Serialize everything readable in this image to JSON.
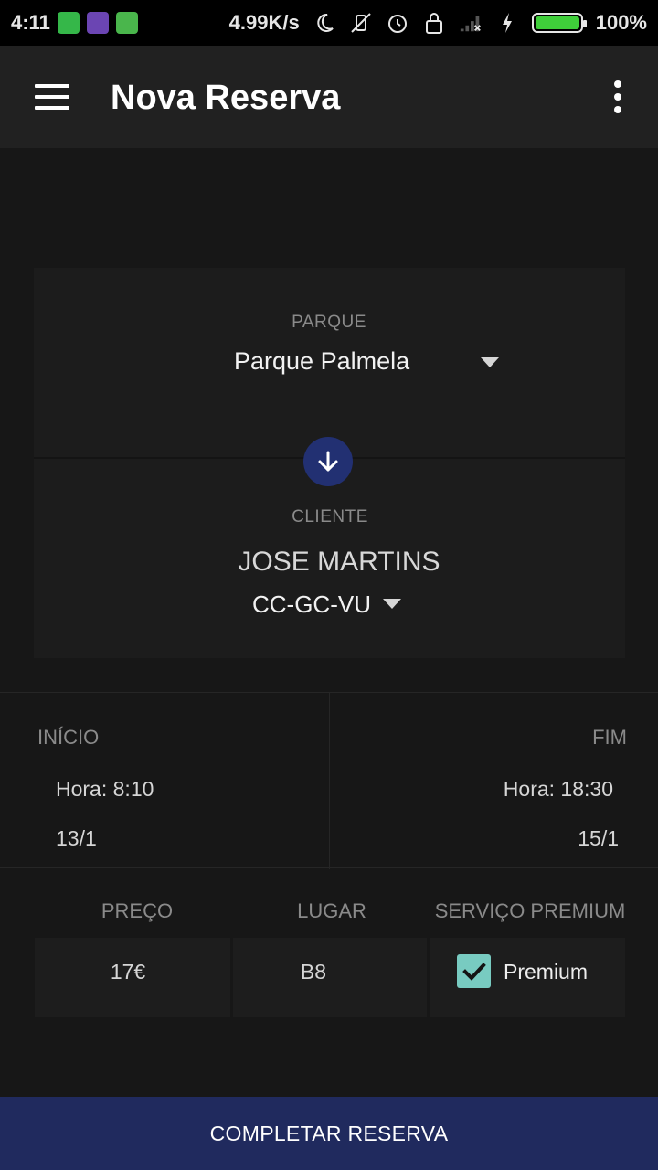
{
  "status_bar": {
    "time": "4:11",
    "network_speed": "4.99K/s",
    "battery_percent": "100%",
    "battery_level": 1.0,
    "icons": [
      "battery-app-icon",
      "twitch-icon",
      "cat-app-icon",
      "moon-icon",
      "vibrate-off-icon",
      "alarm-icon",
      "lock-icon",
      "signal-icon",
      "charging-icon"
    ]
  },
  "appbar": {
    "title": "Nova Reserva",
    "menu_icon": "hamburger-icon",
    "overflow_icon": "more-vert-icon"
  },
  "parque": {
    "label": "PARQUE",
    "value": "Parque Palmela"
  },
  "swap_icon": "arrow-down-icon",
  "cliente": {
    "label": "CLIENTE",
    "name": "JOSE MARTINS",
    "plate": "CC-GC-VU"
  },
  "inicio": {
    "label": "INÍCIO",
    "time": "Hora: 8:10",
    "date": "13/1"
  },
  "fim": {
    "label": "FIM",
    "time": "Hora: 18:30",
    "date": "15/1"
  },
  "details": {
    "price_label": "PREÇO",
    "price_value": "17€",
    "place_label": "LUGAR",
    "place_value": "B8",
    "premium_label": "SERVIÇO PREMIUM",
    "premium_checkbox_label": "Premium",
    "premium_checked": true
  },
  "complete_button": "COMPLETAR RESERVA",
  "colors": {
    "background": "#171717",
    "appbar": "#212121",
    "accent_blue": "#223072",
    "button_bg": "#202a5e",
    "checkbox": "#78cbc1"
  }
}
